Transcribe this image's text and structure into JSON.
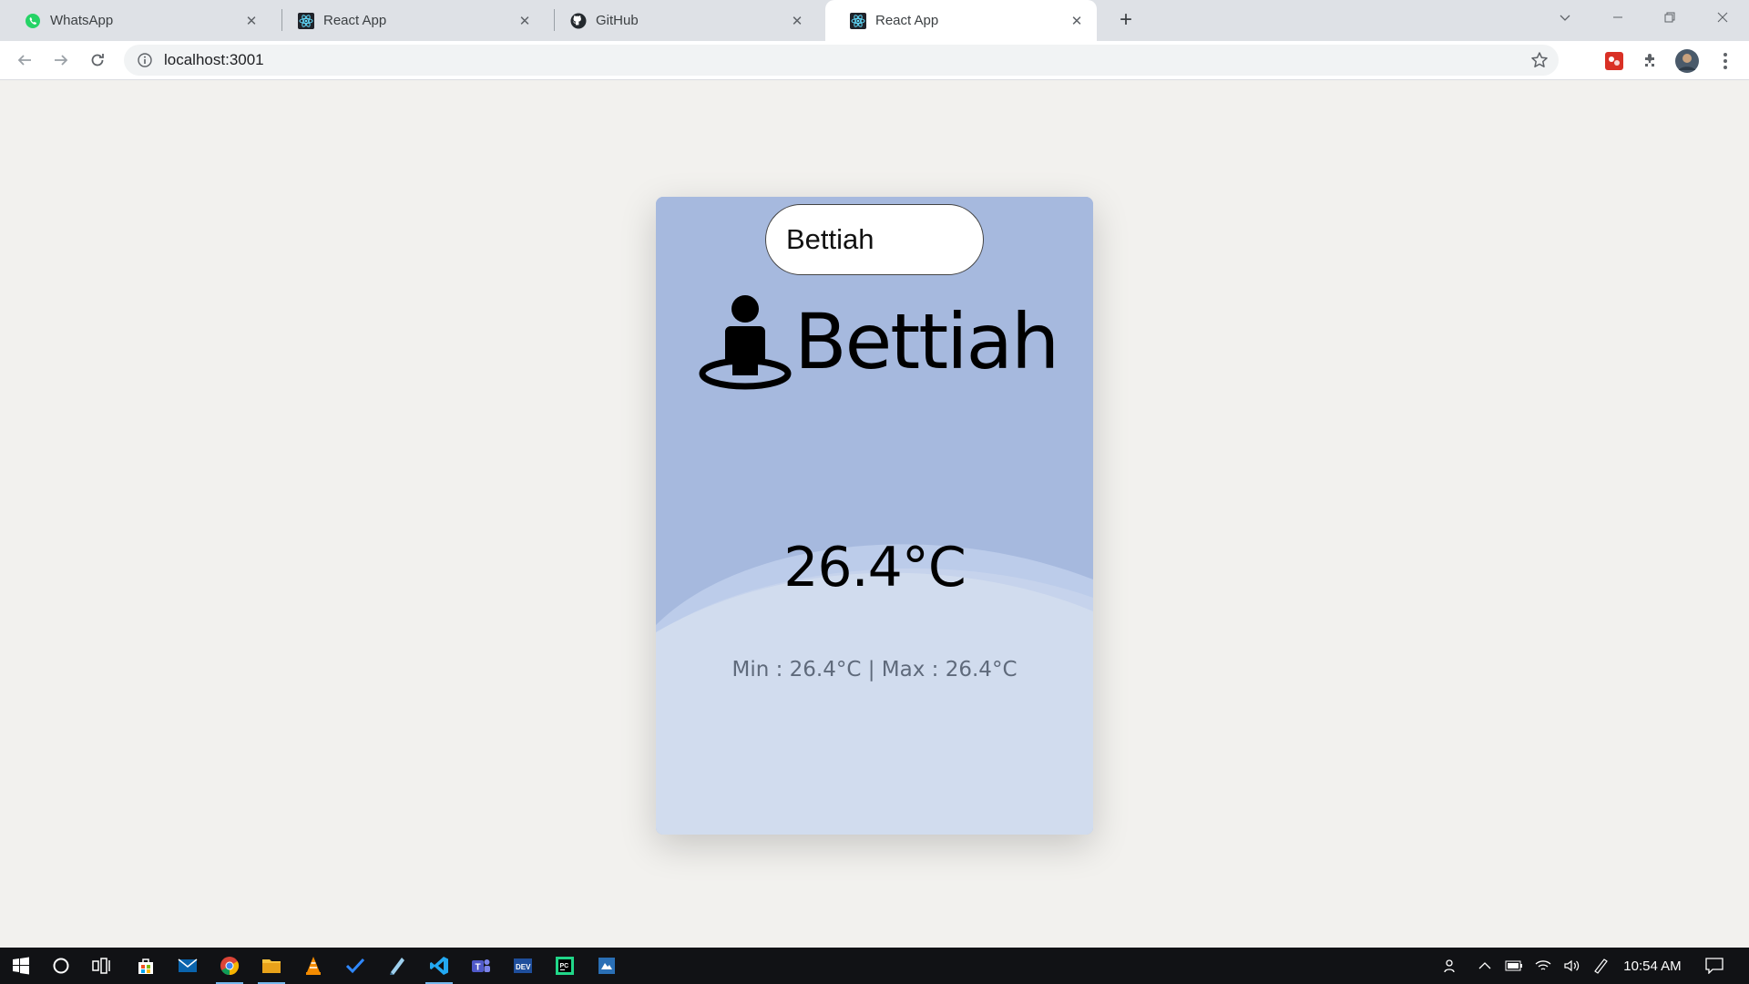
{
  "browser": {
    "tabs": [
      {
        "title": "WhatsApp",
        "icon": "whatsapp-icon",
        "active": false
      },
      {
        "title": "React App",
        "icon": "react-icon",
        "active": false
      },
      {
        "title": "GitHub",
        "icon": "github-icon",
        "active": false
      },
      {
        "title": "React App",
        "icon": "react-icon",
        "active": true
      }
    ],
    "url": "localhost:3001",
    "accent_colors": {
      "tab_strip": "#dee1e6",
      "omnibox": "#f1f3f4"
    }
  },
  "weather": {
    "search_value": "Bettiah",
    "city": "Bettiah",
    "temperature": "26.4°C",
    "minmax": "Min : 26.4°C | Max : 26.4°C",
    "colors": {
      "card_top": "#a6b9de",
      "card_bottom": "#d1dcee",
      "page_bg": "#f2f1ee"
    }
  },
  "taskbar": {
    "apps": [
      "start-icon",
      "search-icon",
      "task-view-icon",
      "store-icon",
      "mail-icon",
      "chrome-icon",
      "file-explorer-icon",
      "vlc-icon",
      "todo-icon",
      "notepad-icon",
      "vscode-icon",
      "teams-icon",
      "devcpp-icon",
      "pycharm-icon",
      "app-icon"
    ],
    "time": "10:54 AM"
  }
}
